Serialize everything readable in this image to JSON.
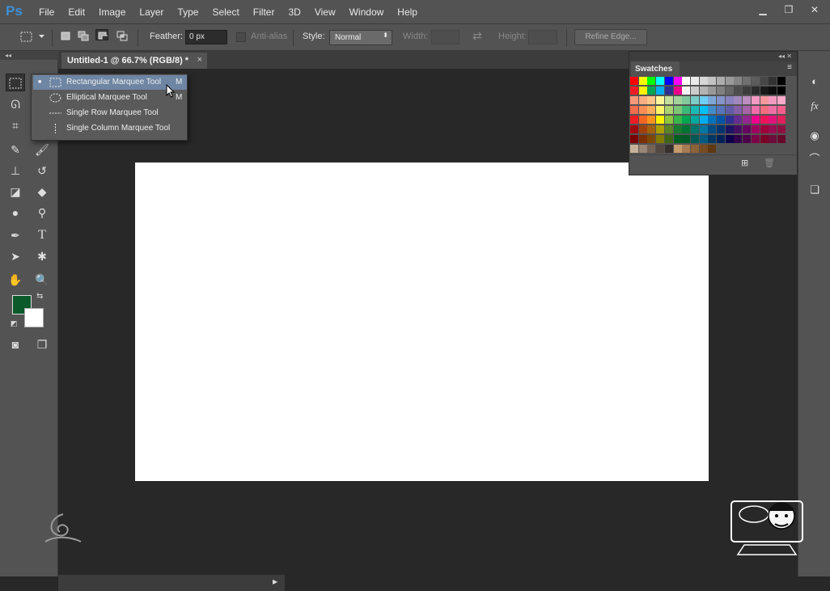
{
  "menubar": {
    "logo": "Ps",
    "items": [
      "File",
      "Edit",
      "Image",
      "Layer",
      "Type",
      "Select",
      "Filter",
      "3D",
      "View",
      "Window",
      "Help"
    ],
    "window_controls": {
      "minimize": "▁",
      "restore": "❐",
      "close": "✕"
    }
  },
  "options_bar": {
    "feather_label": "Feather:",
    "feather_value": "0 px",
    "antialias_label": "Anti-alias",
    "style_label": "Style:",
    "style_value": "Normal",
    "width_label": "Width:",
    "height_label": "Height:",
    "refine_edge_label": "Refine Edge..."
  },
  "toolbox": {
    "collapse": "◂◂"
  },
  "document": {
    "tab_title": "Untitled-1 @ 66.7% (RGB/8) *",
    "close": "×"
  },
  "colors": {
    "foreground": "#0a5a2a",
    "background": "#ffffff"
  },
  "flyout": {
    "items": [
      {
        "label": "Rectangular Marquee Tool",
        "shortcut": "M",
        "selected": true
      },
      {
        "label": "Elliptical Marquee Tool",
        "shortcut": "M",
        "selected": false
      },
      {
        "label": "Single Row Marquee Tool",
        "shortcut": "",
        "selected": false
      },
      {
        "label": "Single Column Marquee Tool",
        "shortcut": "",
        "selected": false
      }
    ]
  },
  "swatches": {
    "title": "Swatches",
    "collapse": "◂◂ ✕",
    "rows": [
      [
        "#ff0000",
        "#ffff00",
        "#00ff00",
        "#00ffff",
        "#0000ff",
        "#ff00ff",
        "#ffffff",
        "#ebebeb",
        "#d6d6d6",
        "#c2c2c2",
        "#adadad",
        "#999999",
        "#858585",
        "#707070",
        "#5c5c5c",
        "#474747",
        "#333333",
        "#000000"
      ],
      [
        "#ed1c24",
        "#fff200",
        "#00a651",
        "#00aeef",
        "#2e3192",
        "#ec008c",
        "#f5f5f5",
        "#cccccc",
        "#b3b3b3",
        "#999999",
        "#808080",
        "#666666",
        "#4d4d4d",
        "#3d3d3d",
        "#2b2b2b",
        "#1a1a1a",
        "#0d0d0d",
        "#000000"
      ],
      [
        "#f7977a",
        "#f9ad81",
        "#fdc68a",
        "#fff79a",
        "#c4df9b",
        "#a3d39c",
        "#82ca9d",
        "#7bcdc8",
        "#6ecff6",
        "#7ea7d8",
        "#8493ca",
        "#8882be",
        "#a187be",
        "#bc8dbf",
        "#f49ac2",
        "#f6989d",
        "#f49ac1",
        "#f8aac8"
      ],
      [
        "#f26c4f",
        "#f68e56",
        "#fbaf5c",
        "#fff467",
        "#acd372",
        "#7cc576",
        "#3bb878",
        "#1abbb4",
        "#00bff3",
        "#438cca",
        "#5574b9",
        "#605ca8",
        "#855fa8",
        "#a763a8",
        "#f06eaa",
        "#f26d7d",
        "#ee6fa5",
        "#f35e8c"
      ],
      [
        "#ed1c24",
        "#f26522",
        "#f7941d",
        "#fff200",
        "#8dc63f",
        "#39b54a",
        "#00a651",
        "#00a99d",
        "#00aeef",
        "#0072bc",
        "#0054a6",
        "#2e3192",
        "#662d91",
        "#92278f",
        "#ec008c",
        "#ed145b",
        "#e2137b",
        "#e01f5c"
      ],
      [
        "#9e0b0f",
        "#a0410d",
        "#a36209",
        "#aba000",
        "#598527",
        "#1a7b30",
        "#007236",
        "#00746b",
        "#0076a3",
        "#004b80",
        "#003471",
        "#1b1464",
        "#440e62",
        "#630460",
        "#9e005d",
        "#9e0039",
        "#970c52",
        "#8c1140"
      ],
      [
        "#790000",
        "#7b2e00",
        "#7d4900",
        "#827b00",
        "#406618",
        "#005e20",
        "#005826",
        "#005952",
        "#005b7f",
        "#003663",
        "#002157",
        "#0d004c",
        "#32004b",
        "#4b0049",
        "#7b0046",
        "#7a0026",
        "#6e0d3b",
        "#660a2c"
      ],
      [
        "#c7b299",
        "#998675",
        "#736357",
        "#534741",
        "#37302d",
        "#c69c6d",
        "#a67c52",
        "#8c6239",
        "#754c24",
        "#603913"
      ]
    ]
  }
}
